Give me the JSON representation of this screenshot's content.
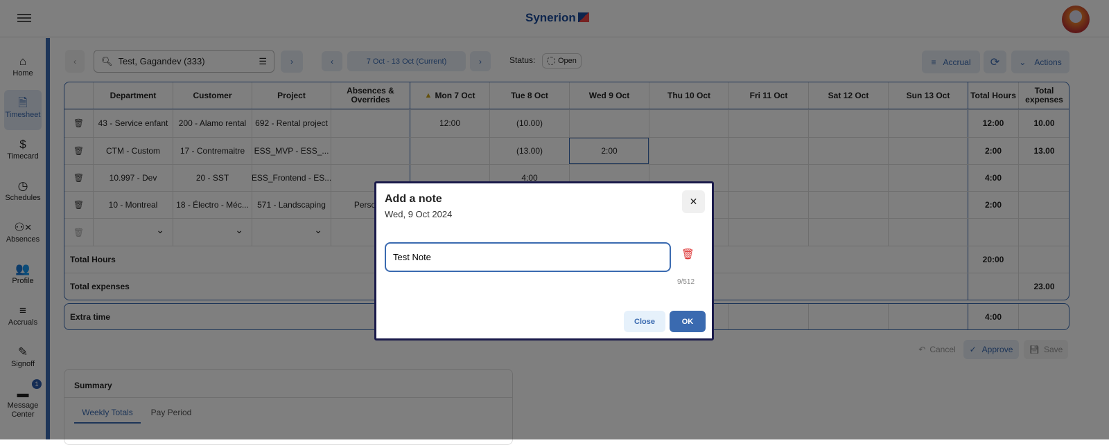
{
  "header": {
    "logo": "Synerion",
    "menu_icon": "hamburger-icon"
  },
  "sidebar": {
    "items": [
      {
        "label": "Home",
        "icon": "⌂"
      },
      {
        "label": "Timesheet",
        "icon": "🗎",
        "active": true
      },
      {
        "label": "Timecard",
        "icon": "$"
      },
      {
        "label": "Schedules",
        "icon": "◷"
      },
      {
        "label": "Absences",
        "icon": "⚇×"
      },
      {
        "label": "Profile",
        "icon": "👥"
      },
      {
        "label": "Accruals",
        "icon": "≡"
      },
      {
        "label": "Signoff",
        "icon": "✎"
      },
      {
        "label": "Message Center",
        "icon": "▬"
      }
    ],
    "message_badge": "1"
  },
  "toolbar": {
    "employee": "Test, Gagandev (333)",
    "period": "7 Oct - 13 Oct (Current)",
    "status_label": "Status:",
    "status_value": "Open",
    "accrual": "Accrual",
    "actions": "Actions"
  },
  "table": {
    "headers": [
      "",
      "Department",
      "Customer",
      "Project",
      "Absences & Overrides",
      "Mon 7 Oct",
      "Tue 8 Oct",
      "Wed 9 Oct",
      "Thu 10 Oct",
      "Fri 11 Oct",
      "Sat 12 Oct",
      "Sun 13 Oct",
      "Total Hours",
      "Total expenses"
    ],
    "warning_day": "Mon 7 Oct",
    "rows": [
      [
        "43 - Service enfant",
        "200 - Alamo rental",
        "692 - Rental project",
        "",
        "12:00",
        "(10.00)",
        "",
        "",
        "",
        "",
        "",
        "12:00",
        "10.00"
      ],
      [
        "CTM - Custom",
        "17 - Contremaitre",
        "ESS_MVP - ESS_...",
        "",
        "",
        "(13.00)",
        "2:00",
        "",
        "",
        "",
        "",
        "2:00",
        "13.00"
      ],
      [
        "10.997 - Dev",
        "20 - SST",
        "ESS_Frontend - ES...",
        "",
        "",
        "4:00",
        "",
        "",
        "",
        "",
        "",
        "4:00",
        ""
      ],
      [
        "10 - Montreal",
        "18 - Électro - Méc...",
        "571 - Landscaping",
        "Personal",
        "",
        "",
        "",
        "",
        "",
        "",
        "",
        "2:00",
        ""
      ]
    ],
    "total_hours_label": "Total Hours",
    "total_hours": "20:00",
    "total_expenses_label": "Total expenses",
    "total_expenses": "23.00",
    "extra_time_label": "Extra time",
    "extra_time": "4:00"
  },
  "footer_actions": {
    "cancel": "Cancel",
    "approve": "Approve",
    "save": "Save"
  },
  "summary": {
    "title": "Summary",
    "tabs": [
      "Weekly Totals",
      "Pay Period"
    ]
  },
  "dialog": {
    "title": "Add a note",
    "date": "Wed, 9 Oct 2024",
    "note_value": "Test Note",
    "counter": "9/512",
    "close": "Close",
    "ok": "OK"
  },
  "colors": {
    "accent": "#3a6ab0",
    "delete": "#dd3333"
  }
}
